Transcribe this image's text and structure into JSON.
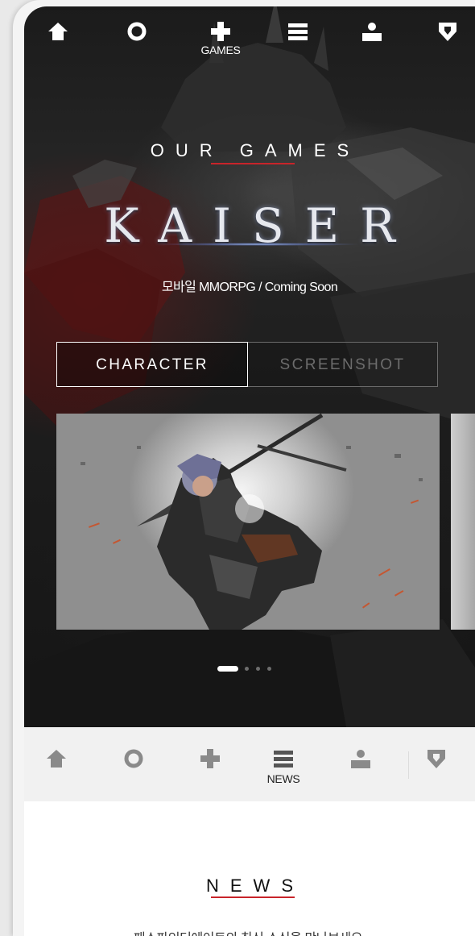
{
  "top_nav": {
    "items": [
      {
        "icon": "home-icon",
        "label": ""
      },
      {
        "icon": "circle-icon",
        "label": ""
      },
      {
        "icon": "plus-icon",
        "label": "GAMES"
      },
      {
        "icon": "menu-icon",
        "label": ""
      },
      {
        "icon": "person-icon",
        "label": ""
      },
      {
        "icon": "shield-icon",
        "label": ""
      }
    ],
    "active_index": 2
  },
  "games_section": {
    "title": "OUR GAMES",
    "game_logo": "KAISER",
    "game_subtitle": "모바일 MMORPG / Coming Soon",
    "tabs": [
      {
        "label": "CHARACTER",
        "active": true
      },
      {
        "label": "SCREENSHOT",
        "active": false
      }
    ],
    "carousel": {
      "slide_count": 4,
      "active_slide": 0
    }
  },
  "sub_nav": {
    "items": [
      {
        "icon": "home-icon",
        "label": ""
      },
      {
        "icon": "circle-icon",
        "label": ""
      },
      {
        "icon": "plus-icon",
        "label": ""
      },
      {
        "icon": "menu-icon",
        "label": "NEWS"
      },
      {
        "icon": "person-icon",
        "label": ""
      },
      {
        "icon": "shield-icon",
        "label": ""
      }
    ],
    "active_index": 3
  },
  "news_section": {
    "title": "NEWS",
    "description": "패스파인더에이트의 최신 소식을 만나보세요."
  },
  "colors": {
    "accent_red": "#c8242a",
    "hero_background": "#1d1d1d",
    "inactive_icon": "#8a8a8a"
  }
}
